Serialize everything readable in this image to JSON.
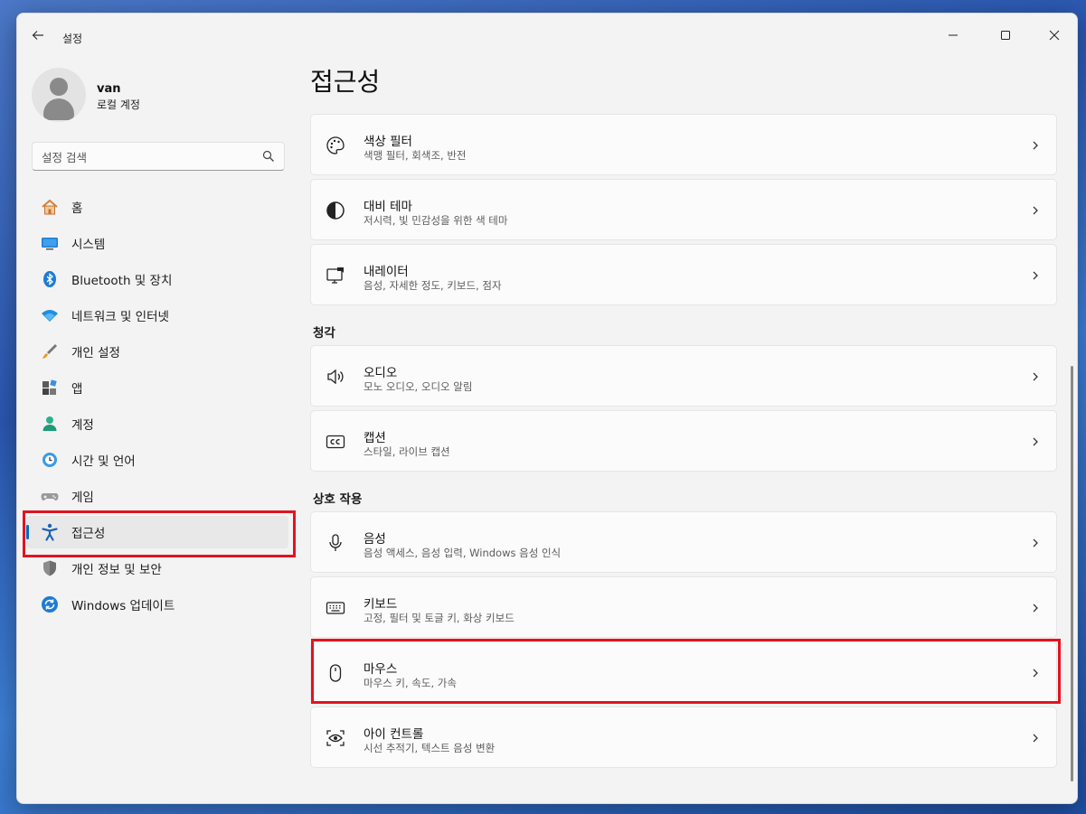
{
  "window": {
    "title": "설정",
    "back_icon": "arrow-left-icon"
  },
  "user": {
    "name": "van",
    "account_type": "로컬 계정"
  },
  "search": {
    "placeholder": "설정 검색",
    "value": ""
  },
  "sidebar": {
    "items": [
      {
        "label": "홈",
        "icon": "home-icon"
      },
      {
        "label": "시스템",
        "icon": "monitor-icon"
      },
      {
        "label": "Bluetooth 및 장치",
        "icon": "bluetooth-icon"
      },
      {
        "label": "네트워크 및 인터넷",
        "icon": "wifi-icon"
      },
      {
        "label": "개인 설정",
        "icon": "brush-icon"
      },
      {
        "label": "앱",
        "icon": "apps-icon"
      },
      {
        "label": "계정",
        "icon": "person-icon"
      },
      {
        "label": "시간 및 언어",
        "icon": "globe-clock-icon"
      },
      {
        "label": "게임",
        "icon": "gamepad-icon"
      },
      {
        "label": "접근성",
        "icon": "accessibility-icon",
        "selected": true
      },
      {
        "label": "개인 정보 및 보안",
        "icon": "shield-icon"
      },
      {
        "label": "Windows 업데이트",
        "icon": "update-icon"
      }
    ]
  },
  "main": {
    "title": "접근성",
    "sections": {
      "hearing": "청각",
      "interaction": "상호 작용"
    },
    "cards": [
      {
        "title": "색상 필터",
        "subtitle": "색맹 필터, 회색조, 반전",
        "icon": "palette-icon"
      },
      {
        "title": "대비 테마",
        "subtitle": "저시력, 빛 민감성을 위한 색 테마",
        "icon": "contrast-icon"
      },
      {
        "title": "내레이터",
        "subtitle": "음성, 자세한 정도, 키보드, 점자",
        "icon": "narrator-icon"
      },
      {
        "title": "오디오",
        "subtitle": "모노 오디오, 오디오 알림",
        "icon": "speaker-icon"
      },
      {
        "title": "캡션",
        "subtitle": "스타일, 라이브 캡션",
        "icon": "cc-icon"
      },
      {
        "title": "음성",
        "subtitle": "음성 액세스, 음성 입력, Windows 음성 인식",
        "icon": "microphone-icon"
      },
      {
        "title": "키보드",
        "subtitle": "고정, 필터 및 토글 키, 화상 키보드",
        "icon": "keyboard-icon"
      },
      {
        "title": "마우스",
        "subtitle": "마우스 키, 속도, 가속",
        "icon": "mouse-icon",
        "highlighted": true
      },
      {
        "title": "아이 컨트롤",
        "subtitle": "시선 추적기, 텍스트 음성 변환",
        "icon": "eye-control-icon"
      }
    ]
  },
  "colors": {
    "accent": "#0067c0",
    "highlight_box": "#e3131f"
  }
}
